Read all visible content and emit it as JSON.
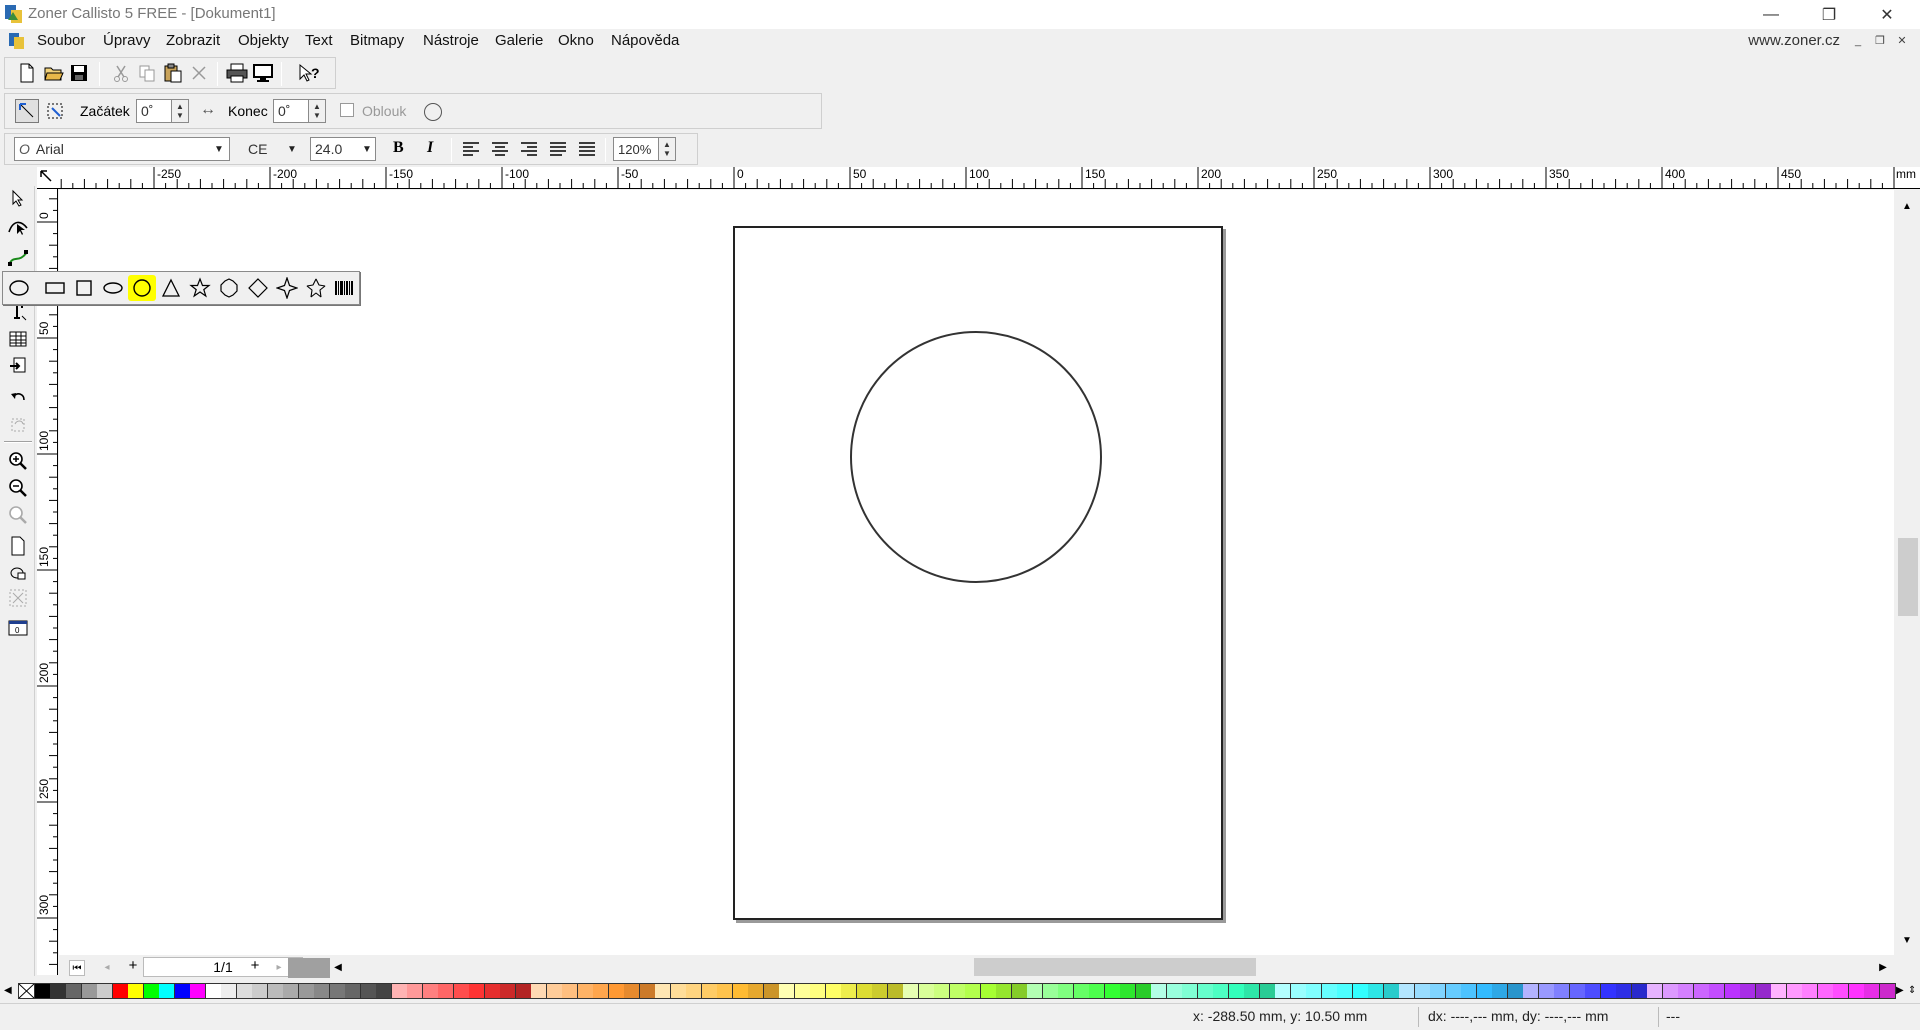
{
  "window": {
    "title": "Zoner Callisto 5 FREE - [Dokument1]",
    "controls": [
      "—",
      "❐",
      "✕"
    ]
  },
  "menu": {
    "items": [
      "Soubor",
      "Úpravy",
      "Zobrazit",
      "Objekty",
      "Text",
      "Bitmapy",
      "Nástroje",
      "Galerie",
      "Okno",
      "Nápověda"
    ],
    "website": "www.zoner.cz"
  },
  "arc_toolbar": {
    "start_label": "Začátek",
    "start_value": "0˚",
    "end_label": "Konec",
    "end_value": "0˚",
    "arc_label": "Oblouk"
  },
  "text_toolbar": {
    "font": "Arial",
    "charset": "CE",
    "size": "24.0",
    "bold": "B",
    "italic": "I",
    "line_spacing": "120%"
  },
  "ruler": {
    "unit": "mm",
    "h_labels": [
      "-250",
      "-200",
      "-150",
      "-100",
      "-50",
      "0",
      "50",
      "100",
      "150",
      "200",
      "250",
      "300",
      "350",
      "400",
      "450"
    ],
    "v_labels": [
      "0",
      "50",
      "100",
      "150",
      "200",
      "250",
      "300"
    ]
  },
  "pager": {
    "page": "1/1"
  },
  "status": {
    "coords": "x: -288.50 mm, y: 10.50 mm",
    "delta": "dx: ----,--- mm, dy: ----,--- mm",
    "extra": "---"
  },
  "colors": {
    "accent_selected": "#ffff00",
    "palette": [
      "#000000",
      "#333333",
      "#666666",
      "#999999",
      "#cccccc",
      "#ff0000",
      "#ffff00",
      "#00ff00",
      "#00ffff",
      "#0000ff",
      "#ff00ff",
      "#ffffff",
      "#eeeeee",
      "#dddddd",
      "#cccccc",
      "#bbbbbb",
      "#aaaaaa",
      "#999999",
      "#888888",
      "#777777",
      "#666666",
      "#555555",
      "#444444",
      "#ffb3b3",
      "#ff9999",
      "#ff8080",
      "#ff6666",
      "#ff4d4d",
      "#ff3333",
      "#e62e2e",
      "#cc2929",
      "#b32424",
      "#ffd9b3",
      "#ffcc99",
      "#ffbf80",
      "#ffb366",
      "#ffa64d",
      "#ff9933",
      "#e68a2e",
      "#cc7a29",
      "#ffe6b3",
      "#ffdd99",
      "#ffd480",
      "#ffcc66",
      "#ffc34d",
      "#ffbb33",
      "#e6a82e",
      "#cc9529",
      "#ffffb3",
      "#ffff99",
      "#ffff80",
      "#ffff66",
      "#eeee4d",
      "#dddd33",
      "#cccc2e",
      "#bbbb29",
      "#e6ffb3",
      "#d9ff99",
      "#ccff80",
      "#bfff66",
      "#b3ff4d",
      "#a6ff33",
      "#95e62e",
      "#85cc29",
      "#b3ffb3",
      "#99ff99",
      "#80ff80",
      "#66ff66",
      "#4dff4d",
      "#33ff33",
      "#2ee62e",
      "#29cc29",
      "#b3ffe6",
      "#99ffdd",
      "#80ffd4",
      "#66ffcc",
      "#4dffc3",
      "#33ffbb",
      "#2ee6a8",
      "#29cc95",
      "#b3ffff",
      "#99ffff",
      "#80ffff",
      "#66ffff",
      "#4dffff",
      "#33ffff",
      "#2ee6e6",
      "#29cccc",
      "#b3e6ff",
      "#99ddff",
      "#80d4ff",
      "#66ccff",
      "#4dc3ff",
      "#33bbff",
      "#2ea8e6",
      "#2995cc",
      "#b3b3ff",
      "#9999ff",
      "#8080ff",
      "#6666ff",
      "#4d4dff",
      "#3333ff",
      "#2e2ee6",
      "#2929cc",
      "#e6b3ff",
      "#dd99ff",
      "#d480ff",
      "#cc66ff",
      "#c34dff",
      "#bb33ff",
      "#a82ee6",
      "#9529cc",
      "#ffb3ff",
      "#ff99ff",
      "#ff80ff",
      "#ff66ff",
      "#ff4dff",
      "#ff33ff",
      "#e62ee6",
      "#cc29cc"
    ]
  }
}
